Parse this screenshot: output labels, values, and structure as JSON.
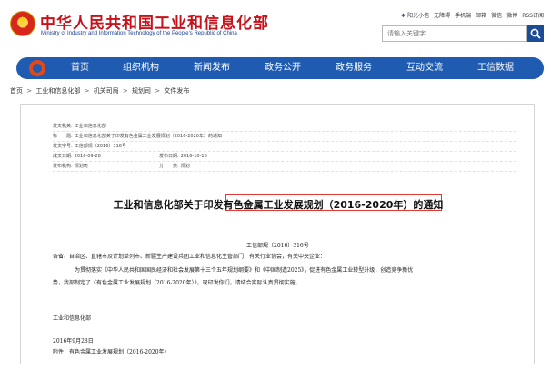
{
  "header": {
    "site_title": "中华人民共和国工业和信息化部",
    "site_subtitle": "Ministry of Industry and Information Technology of the People's Republic of China",
    "top_links": [
      "阳光小信",
      "无障碍",
      "手机端",
      "邮箱",
      "微信",
      "微博",
      "RSS订阅"
    ],
    "search_placeholder": "请输入关键字",
    "search_icon": "search-icon"
  },
  "nav": {
    "items": [
      "首页",
      "组织机构",
      "新闻发布",
      "政务公开",
      "政务服务",
      "互动交流",
      "工信数据"
    ]
  },
  "breadcrumb": [
    "首页",
    "工业和信息化部",
    "机关司局",
    "规划司",
    "文件发布"
  ],
  "breadcrumb_separator": ">",
  "meta": {
    "issuer_label": "发文机关:",
    "issuer_value": "工业和信息化部",
    "subject_label": "标　　题:",
    "subject_value": "工业和信息化部关于印发有色金属工业发展规划（2016-2020年）的通知",
    "doc_no_label": "发文字号:",
    "doc_no_value": "工信部规〔2016〕316号",
    "written_label": "成文日期:",
    "written_value": "2016-09-28",
    "published_label": "发布日期:",
    "published_value": "2016-10-18",
    "org_label": "发布机构:",
    "org_value": "规划司",
    "category_label": "分　　类:",
    "category_value": "规划"
  },
  "document": {
    "title": "工业和信息化部关于印发有色金属工业发展规划（2016-2020年）的通知",
    "number": "工信部规〔2016〕316号",
    "recipients": "各省、自治区、直辖市及计划单列市、新疆生产建设兵团工业和信息化主管部门，有关行业协会，有关中央企业：",
    "paragraph_line1": "为贯彻落实《中华人民共和国国民经济和社会发展第十三个五年规划纲要》和《中国制造2025》，促进有色金属工业转型升级，创造竞争新优",
    "paragraph_line2": "势，我部制定了《有色金属工业发展规划（2016-2020年）》，现印发你们，请结合实际认真贯彻实施。",
    "signature": "工业和信息化部",
    "date": "2016年9月28日",
    "attachment": "附件：有色金属工业发展规划（2016-2020年）"
  },
  "colors": {
    "brand_red": "#c8121b",
    "nav_blue": "#1f5bb0",
    "highlight_red": "#e53935"
  }
}
